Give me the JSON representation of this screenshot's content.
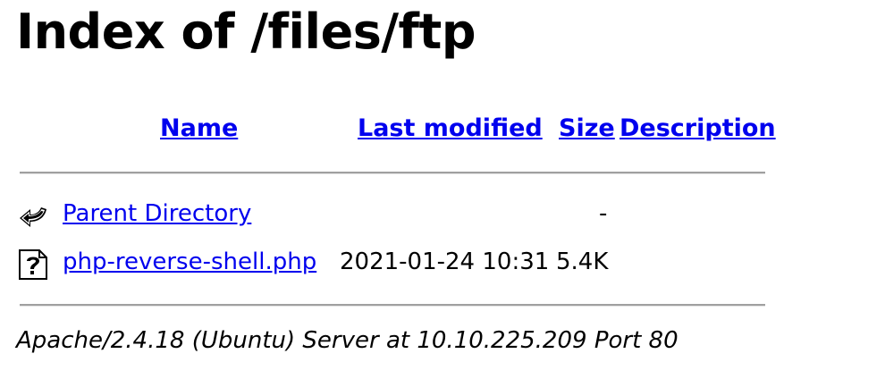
{
  "title": "Index of /files/ftp",
  "columns": {
    "name": "Name",
    "last_modified": "Last modified",
    "size": "Size",
    "description": "Description"
  },
  "rows": [
    {
      "icon": "back-arrow-icon",
      "name": "Parent Directory",
      "last_modified": "",
      "size": "-",
      "description": ""
    },
    {
      "icon": "unknown-file-icon",
      "name": "php-reverse-shell.php",
      "last_modified": "2021-01-24 10:31",
      "size": "5.4K",
      "description": ""
    }
  ],
  "footer": "Apache/2.4.18 (Ubuntu) Server at 10.10.225.209 Port 80",
  "colors": {
    "link": "#0000ee",
    "text": "#000000",
    "rule": "#a0a0a0"
  }
}
